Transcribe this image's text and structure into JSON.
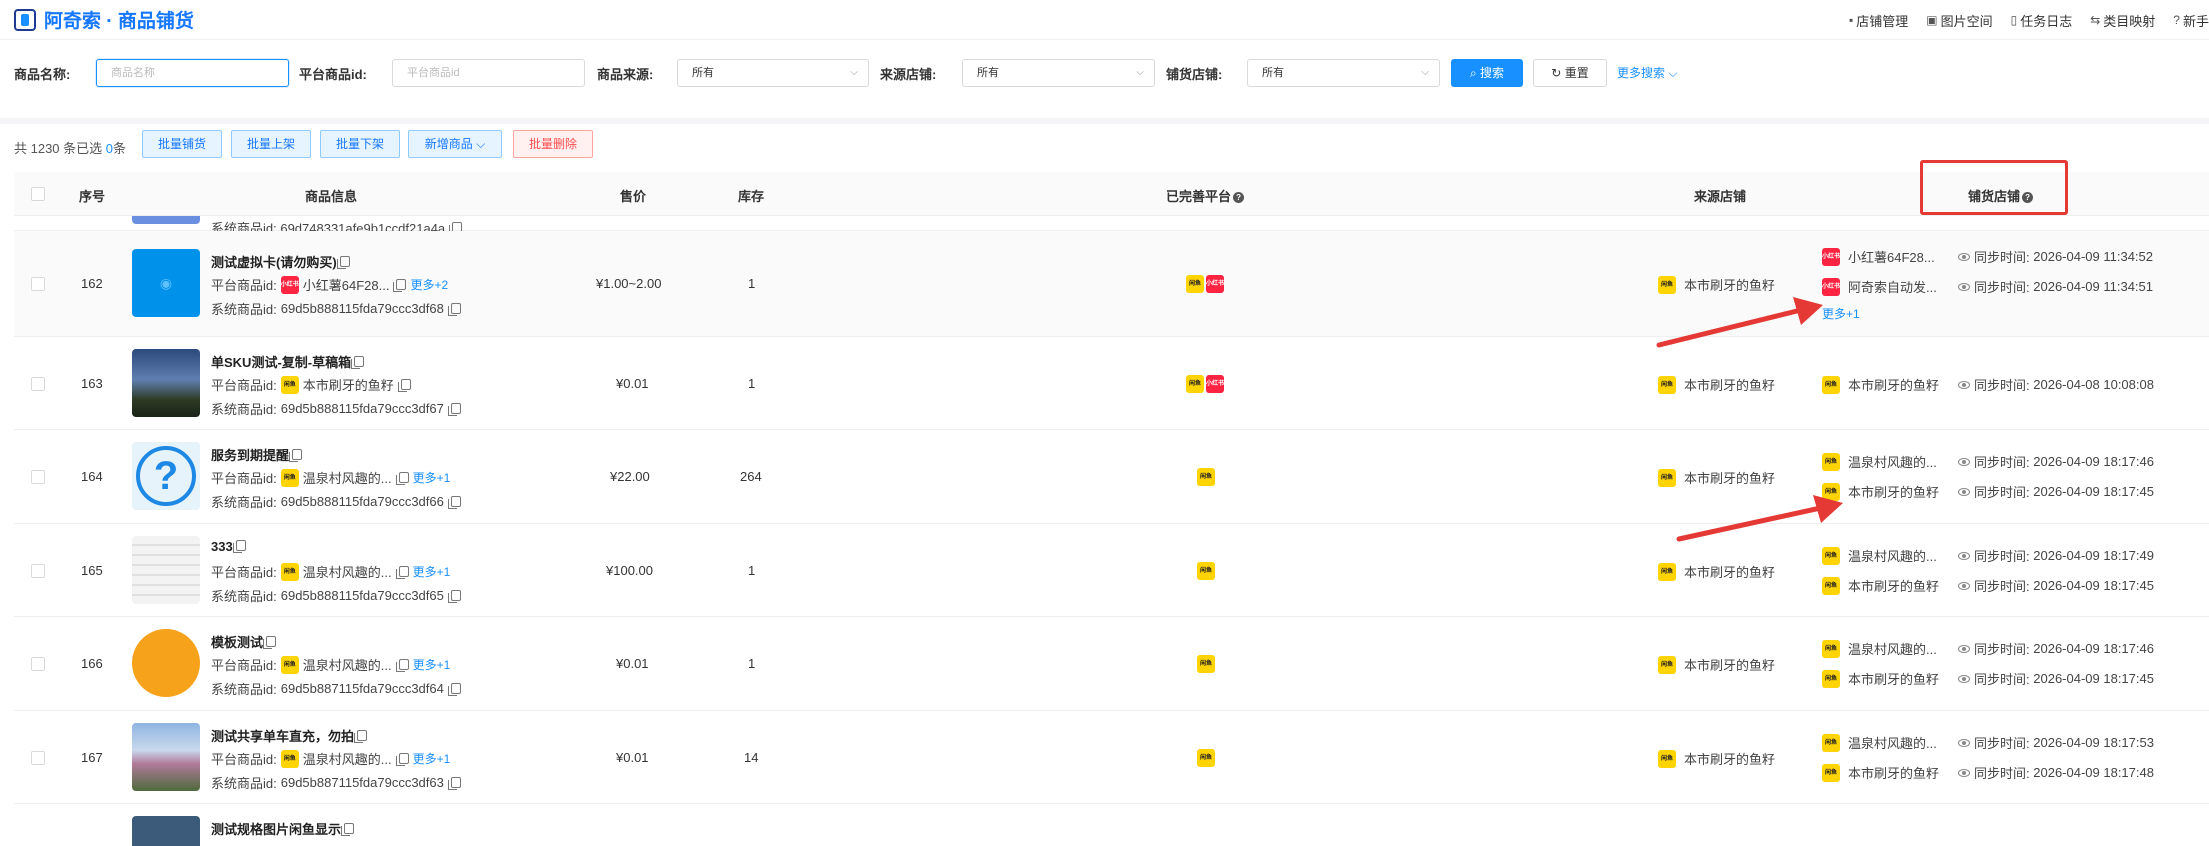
{
  "header": {
    "title": "阿奇索 · 商品铺货",
    "nav": [
      {
        "icon": "shop-icon",
        "label": "店铺管理"
      },
      {
        "icon": "image-icon",
        "label": "图片空间"
      },
      {
        "icon": "log-icon",
        "label": "任务日志"
      },
      {
        "icon": "map-icon",
        "label": "类目映射"
      },
      {
        "icon": "help-icon",
        "label": "新手"
      }
    ]
  },
  "filters": {
    "name_label": "商品名称:",
    "name_placeholder": "商品名称",
    "pid_label": "平台商品id:",
    "pid_placeholder": "平台商品id",
    "source_label": "商品来源:",
    "source_value": "所有",
    "src_shop_label": "来源店铺:",
    "src_shop_value": "所有",
    "dist_shop_label": "铺货店铺:",
    "dist_shop_value": "所有",
    "search_label": "搜索",
    "reset_label": "重置",
    "more_label": "更多搜索"
  },
  "toolbar": {
    "count_prefix": "共 1230 条已选 ",
    "selected": "0",
    "count_suffix": "条",
    "buttons": [
      "批量铺货",
      "批量上架",
      "批量下架",
      "新增商品",
      "批量删除"
    ]
  },
  "table": {
    "columns": {
      "index": "序号",
      "info": "商品信息",
      "price": "售价",
      "stock": "库存",
      "platforms": "已完善平台",
      "source": "来源店铺",
      "dist": "铺货店铺"
    },
    "partial_top_sys_id": "系统商品id:  69d748331afe9b1ccdf21a4a",
    "pid_label": "平台商品id:",
    "sys_label": "系统商品id:",
    "sync_label": "同步时间:",
    "source_shop": "本市刷牙的鱼籽",
    "rows": [
      {
        "index": "162",
        "name": "测试虚拟卡(请勿购买)",
        "pid_shop": "小红薯64F28...",
        "pid_more": "更多+2",
        "sys_id": "69d5b888115fda79ccc3df68",
        "price": "¥1.00~2.00",
        "stock": "1",
        "dist": [
          {
            "shop": "小红薯64F28...",
            "time": "2026-04-09 11:34:52"
          },
          {
            "shop": "阿奇索自动发...",
            "time": "2026-04-09 11:34:51"
          }
        ],
        "dist_more": "更多+1"
      },
      {
        "index": "163",
        "name": "单SKU测试-复制-草稿箱",
        "pid_shop": "本市刷牙的鱼籽",
        "pid_more": "",
        "sys_id": "69d5b888115fda79ccc3df67",
        "price": "¥0.01",
        "stock": "1",
        "dist": [
          {
            "shop": "本市刷牙的鱼籽",
            "time": "2026-04-08 10:08:08"
          }
        ]
      },
      {
        "index": "164",
        "name": "服务到期提醒",
        "pid_shop": "温泉村风趣的...",
        "pid_more": "更多+1",
        "sys_id": "69d5b888115fda79ccc3df66",
        "price": "¥22.00",
        "stock": "264",
        "dist": [
          {
            "shop": "温泉村风趣的...",
            "time": "2026-04-09 18:17:46"
          },
          {
            "shop": "本市刷牙的鱼籽",
            "time": "2026-04-09 18:17:45"
          }
        ]
      },
      {
        "index": "165",
        "name": "333",
        "pid_shop": "温泉村风趣的...",
        "pid_more": "更多+1",
        "sys_id": "69d5b888115fda79ccc3df65",
        "price": "¥100.00",
        "stock": "1",
        "dist": [
          {
            "shop": "温泉村风趣的...",
            "time": "2026-04-09 18:17:49"
          },
          {
            "shop": "本市刷牙的鱼籽",
            "time": "2026-04-09 18:17:45"
          }
        ]
      },
      {
        "index": "166",
        "name": "模板测试",
        "pid_shop": "温泉村风趣的...",
        "pid_more": "更多+1",
        "sys_id": "69d5b887115fda79ccc3df64",
        "price": "¥0.01",
        "stock": "1",
        "dist": [
          {
            "shop": "温泉村风趣的...",
            "time": "2026-04-09 18:17:46"
          },
          {
            "shop": "本市刷牙的鱼籽",
            "time": "2026-04-09 18:17:45"
          }
        ]
      },
      {
        "index": "167",
        "name": "测试共享单车直充，勿拍",
        "pid_shop": "温泉村风趣的...",
        "pid_more": "更多+1",
        "sys_id": "69d5b887115fda79ccc3df63",
        "price": "¥0.01",
        "stock": "14",
        "dist": [
          {
            "shop": "温泉村风趣的...",
            "time": "2026-04-09 18:17:53"
          },
          {
            "shop": "本市刷牙的鱼籽",
            "time": "2026-04-09 18:17:48"
          }
        ]
      }
    ],
    "partial_bottom_name": "测试规格图片闲鱼显示"
  },
  "badges": {
    "xianyu": "闲鱼",
    "xhs": "小红书"
  },
  "colors": {
    "accent": "#1890ff",
    "xianyu": "#ffd400",
    "xhs": "#ff2442",
    "annotation": "#e53935"
  }
}
